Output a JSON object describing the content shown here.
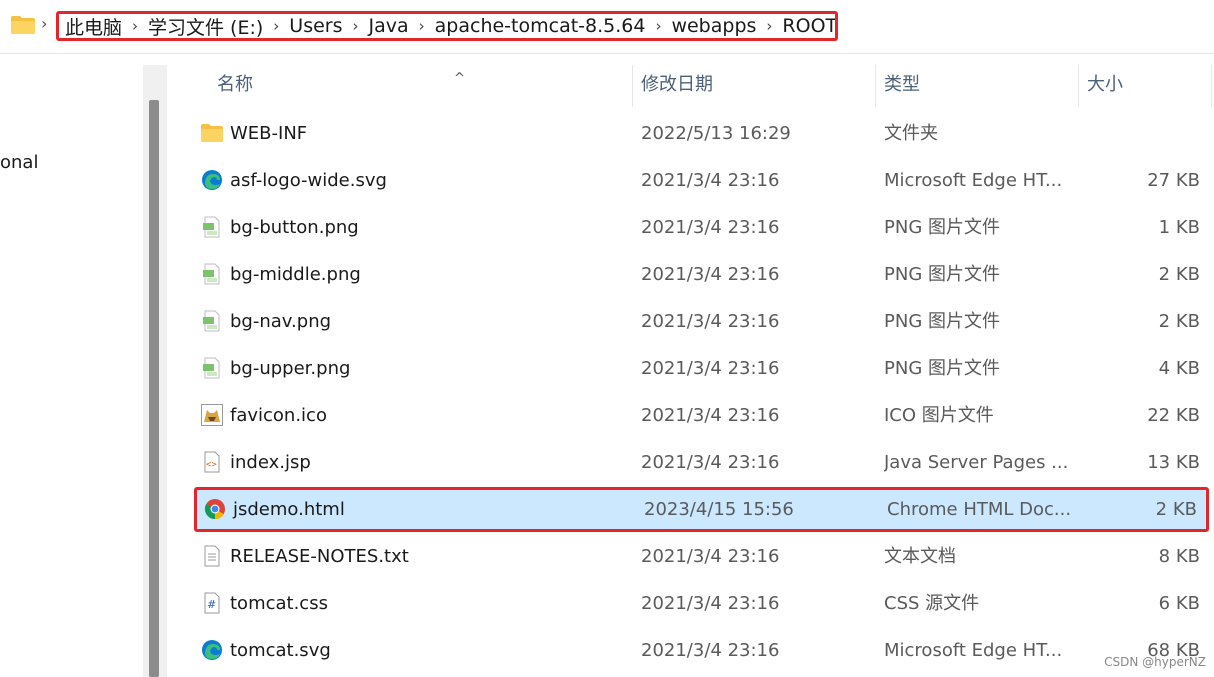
{
  "breadcrumb": [
    "此电脑",
    "学习文件 (E:)",
    "Users",
    "Java",
    "apache-tomcat-8.5.64",
    "webapps",
    "ROOT"
  ],
  "nav": {
    "partial_item": "onal"
  },
  "columns": {
    "name": "名称",
    "modified": "修改日期",
    "type": "类型",
    "size": "大小"
  },
  "files": [
    {
      "name": "WEB-INF",
      "date": "2022/5/13 16:29",
      "type": "文件夹",
      "size": "",
      "icon": "folder-icon"
    },
    {
      "name": "asf-logo-wide.svg",
      "date": "2021/3/4 23:16",
      "type": "Microsoft Edge HT...",
      "size": "27 KB",
      "icon": "edge-icon"
    },
    {
      "name": "bg-button.png",
      "date": "2021/3/4 23:16",
      "type": "PNG 图片文件",
      "size": "1 KB",
      "icon": "png-file-icon"
    },
    {
      "name": "bg-middle.png",
      "date": "2021/3/4 23:16",
      "type": "PNG 图片文件",
      "size": "2 KB",
      "icon": "png-file-icon"
    },
    {
      "name": "bg-nav.png",
      "date": "2021/3/4 23:16",
      "type": "PNG 图片文件",
      "size": "2 KB",
      "icon": "png-file-icon"
    },
    {
      "name": "bg-upper.png",
      "date": "2021/3/4 23:16",
      "type": "PNG 图片文件",
      "size": "4 KB",
      "icon": "png-file-icon"
    },
    {
      "name": "favicon.ico",
      "date": "2021/3/4 23:16",
      "type": "ICO 图片文件",
      "size": "22 KB",
      "icon": "tomcat-cat-icon"
    },
    {
      "name": "index.jsp",
      "date": "2021/3/4 23:16",
      "type": "Java Server Pages ...",
      "size": "13 KB",
      "icon": "code-file-icon"
    },
    {
      "name": "jsdemo.html",
      "date": "2023/4/15 15:56",
      "type": "Chrome HTML Doc...",
      "size": "2 KB",
      "icon": "chrome-icon",
      "selected": true
    },
    {
      "name": "RELEASE-NOTES.txt",
      "date": "2021/3/4 23:16",
      "type": "文本文档",
      "size": "8 KB",
      "icon": "text-file-icon"
    },
    {
      "name": "tomcat.css",
      "date": "2021/3/4 23:16",
      "type": "CSS 源文件",
      "size": "6 KB",
      "icon": "css-file-icon"
    },
    {
      "name": "tomcat.svg",
      "date": "2021/3/4 23:16",
      "type": "Microsoft Edge HT...",
      "size": "68 KB",
      "icon": "edge-icon"
    }
  ],
  "watermark": "CSDN @hyperNZ",
  "colors": {
    "selection": "#cce8ff",
    "highlight_border": "#e3262b",
    "folder": "#f6c141"
  }
}
